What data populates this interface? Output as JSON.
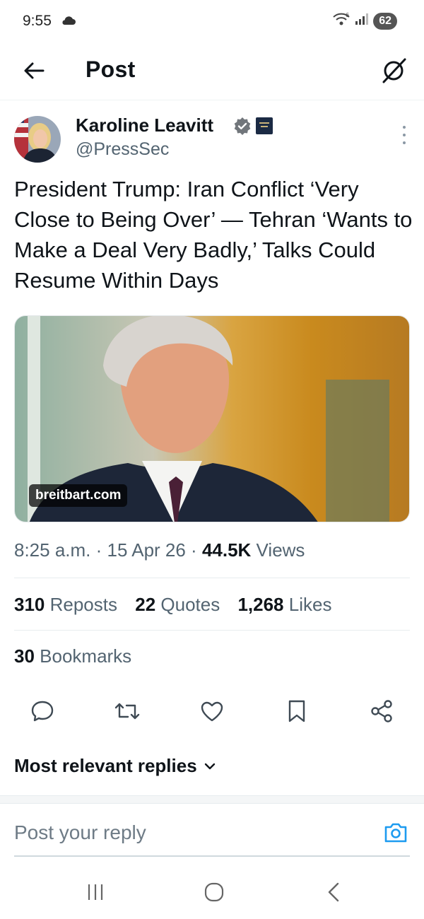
{
  "status_bar": {
    "time": "9:55",
    "battery": "62",
    "icons": [
      "cloud-icon",
      "wifi-icon",
      "signal-icon",
      "battery-icon"
    ]
  },
  "top_bar": {
    "title": "Post",
    "back_icon": "arrow-left-icon",
    "grok_icon": "grok-icon"
  },
  "post": {
    "author_name": "Karoline Leavitt",
    "author_handle": "@PressSec",
    "verified": true,
    "affiliation_badge": "white-house-badge",
    "text": "President Trump: Iran Conflict ‘Very Close to Being Over’ — Tehran ‘Wants to Make a Deal Very Badly,’ Talks Could Resume Within Days",
    "media_source": "breitbart.com",
    "time": "8:25 a.m.",
    "date": "15 Apr 26",
    "views_count": "44.5K",
    "views_label": " Views"
  },
  "stats": {
    "reposts_count": "310",
    "reposts_label": " Reposts",
    "quotes_count": "22",
    "quotes_label": " Quotes",
    "likes_count": "1,268",
    "likes_label": " Likes",
    "bookmarks_count": "30",
    "bookmarks_label": " Bookmarks"
  },
  "actions": [
    "reply-icon",
    "repost-icon",
    "like-icon",
    "bookmark-icon",
    "share-icon"
  ],
  "replies": {
    "sort_label": "Most relevant replies",
    "reply_placeholder": "Post your reply"
  },
  "colors": {
    "accent": "#1d9bf0",
    "text_primary": "#0f1419",
    "text_secondary": "#536471"
  }
}
